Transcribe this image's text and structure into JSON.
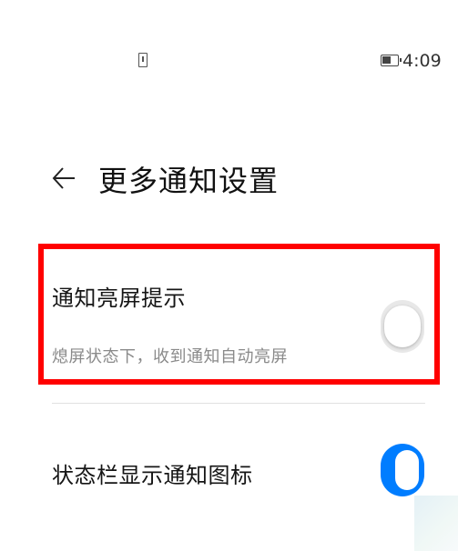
{
  "status_bar": {
    "time": "4:09",
    "sim_icon": "sim-card-alert-icon",
    "battery_icon": "battery-icon"
  },
  "header": {
    "back_icon": "back-arrow-icon",
    "title": "更多通知设置"
  },
  "settings": [
    {
      "title": "通知亮屏提示",
      "subtitle": "熄屏状态下，收到通知自动亮屏",
      "enabled": false,
      "highlighted": true,
      "highlight_color": "#ff0000"
    },
    {
      "title": "状态栏显示通知图标",
      "enabled": true
    }
  ],
  "colors": {
    "toggle_on": "#007dff",
    "toggle_off": "#e8e8e8"
  }
}
